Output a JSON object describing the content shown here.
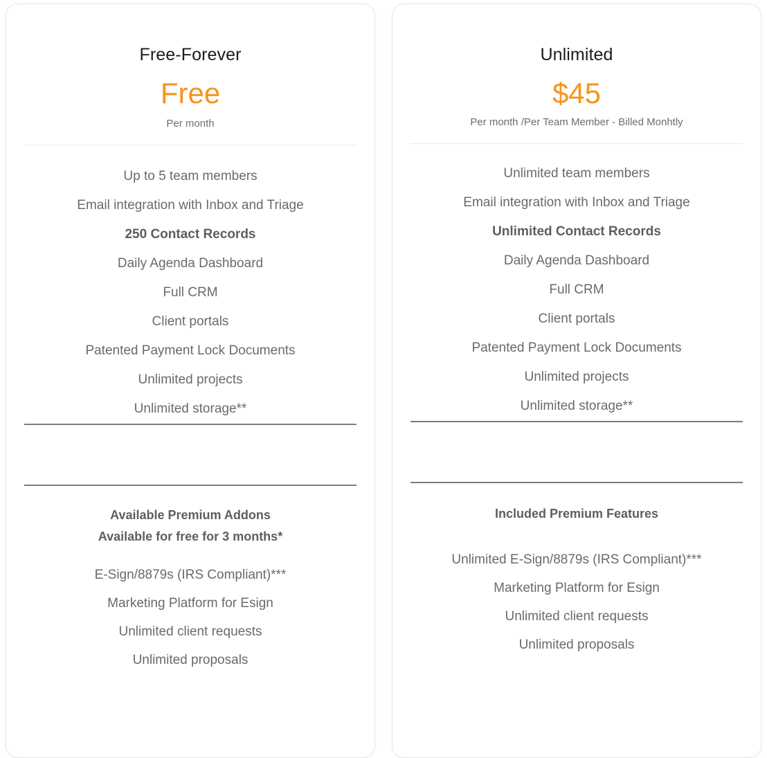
{
  "theme": {
    "accent_color": "#F7941E",
    "feature_text_color": "#6a6a6a",
    "plan_name_color": "#1c1c1c",
    "divider_light_color": "#ececec",
    "divider_dark_color": "#7c7c7c",
    "card_background": "#ffffff",
    "page_background": "#ffffff"
  },
  "plans": [
    {
      "name": "Free-Forever",
      "price": "Free",
      "period": "Per month",
      "features": [
        {
          "label": "Up to 5 team members",
          "bold": false
        },
        {
          "label": "Email integration with Inbox and Triage",
          "bold": false
        },
        {
          "label": "250 Contact Records",
          "bold": true
        },
        {
          "label": "Daily Agenda Dashboard",
          "bold": false
        },
        {
          "label": "Full CRM",
          "bold": false
        },
        {
          "label": "Client portals",
          "bold": false
        },
        {
          "label": "Patented Payment Lock Documents",
          "bold": false
        },
        {
          "label": "Unlimited projects",
          "bold": false
        },
        {
          "label": "Unlimited storage**",
          "bold": false
        }
      ],
      "addons": {
        "title_line_1": "Available Premium Addons",
        "title_line_2": "Available for free for 3 months*",
        "items": [
          "E-Sign/8879s (IRS Compliant)***",
          "Marketing Platform for Esign",
          "Unlimited client requests",
          "Unlimited proposals"
        ]
      }
    },
    {
      "name": "Unlimited",
      "price": "$45",
      "period": "Per month /Per Team Member - Billed Monhtly",
      "features": [
        {
          "label": "Unlimited team members",
          "bold": false
        },
        {
          "label": "Email integration with Inbox and Triage",
          "bold": false
        },
        {
          "label": "Unlimited Contact Records",
          "bold": true
        },
        {
          "label": "Daily Agenda Dashboard",
          "bold": false
        },
        {
          "label": "Full CRM",
          "bold": false
        },
        {
          "label": "Client portals",
          "bold": false
        },
        {
          "label": "Patented Payment Lock Documents",
          "bold": false
        },
        {
          "label": "Unlimited projects",
          "bold": false
        },
        {
          "label": "Unlimited storage**",
          "bold": false
        }
      ],
      "addons": {
        "title_line_1": "Included Premium Features",
        "title_line_2": "",
        "items": [
          "Unlimited E-Sign/8879s (IRS Compliant)***",
          "Marketing Platform for Esign",
          "Unlimited client requests",
          "Unlimited proposals"
        ]
      }
    }
  ]
}
